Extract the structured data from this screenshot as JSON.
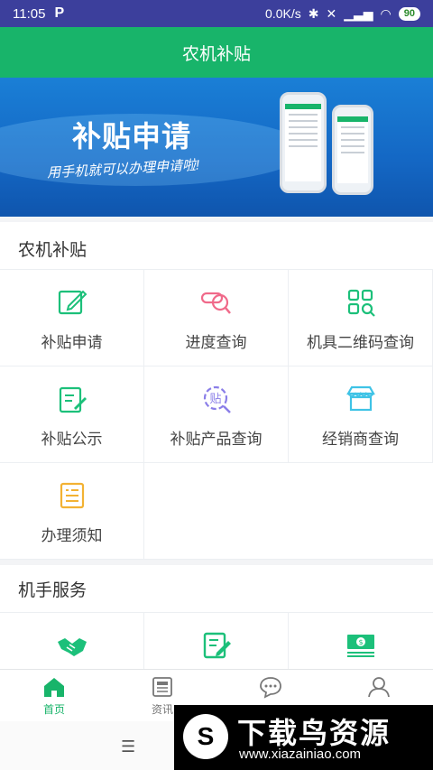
{
  "status_bar": {
    "time": "11:05",
    "app_indicator": "P",
    "network_speed": "0.0K/s",
    "battery": "90"
  },
  "header": {
    "title": "农机补贴"
  },
  "banner": {
    "title": "补贴申请",
    "subtitle": "用手机就可以办理申请啦!"
  },
  "section1": {
    "title": "农机补贴",
    "items": [
      {
        "label": "补贴申请",
        "icon": "edit-icon"
      },
      {
        "label": "进度查询",
        "icon": "search-progress-icon"
      },
      {
        "label": "机具二维码查询",
        "icon": "qr-code-icon"
      },
      {
        "label": "补贴公示",
        "icon": "notice-icon"
      },
      {
        "label": "补贴产品查询",
        "icon": "product-search-icon"
      },
      {
        "label": "经销商查询",
        "icon": "store-icon"
      },
      {
        "label": "办理须知",
        "icon": "guide-icon"
      }
    ]
  },
  "section2": {
    "title": "机手服务",
    "items": [
      {
        "icon": "handshake-icon"
      },
      {
        "icon": "form-icon"
      },
      {
        "icon": "money-icon"
      }
    ]
  },
  "tabs": [
    {
      "label": "首页",
      "icon": "home-icon",
      "active": true
    },
    {
      "label": "资讯",
      "icon": "news-icon",
      "active": false
    },
    {
      "label": "",
      "icon": "message-icon",
      "active": false
    },
    {
      "label": "",
      "icon": "user-icon",
      "active": false
    }
  ],
  "watermark": {
    "logo": "S",
    "brand": "下载鸟资源",
    "url": "www.xiazainiao.com"
  },
  "colors": {
    "status_bar": "#3c3f9c",
    "primary": "#18b46a",
    "banner": "#1467c4"
  }
}
